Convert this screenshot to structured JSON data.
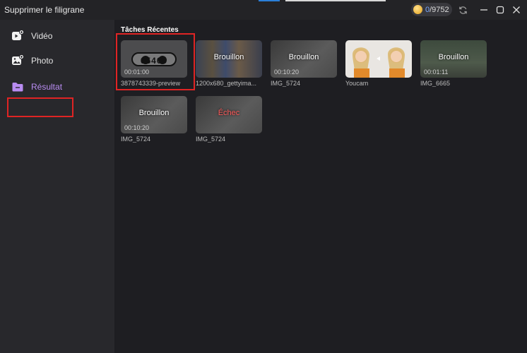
{
  "window": {
    "title": "Supprimer le filigrane",
    "credits_used": "0",
    "credits_total": "/9752"
  },
  "sidebar": {
    "items": [
      {
        "label": "Vidéo",
        "icon": "video-icon"
      },
      {
        "label": "Photo",
        "icon": "photo-icon"
      },
      {
        "label": "Résultat",
        "icon": "folder-icon",
        "active": true
      }
    ]
  },
  "main": {
    "section_title": "Tâches Récentes",
    "cards": [
      {
        "name": "3878743339-preview",
        "status": "",
        "duration": "00:01:00",
        "overlay": "05400"
      },
      {
        "name": "1200x680_gettyima...",
        "status": "Brouillon",
        "duration": ""
      },
      {
        "name": "IMG_5724",
        "status": "Brouillon",
        "duration": "00:10:20"
      },
      {
        "name": "Youcam",
        "status": "",
        "duration": ""
      },
      {
        "name": "IMG_6665",
        "status": "Brouillon",
        "duration": "00:01:11"
      },
      {
        "name": "IMG_5724",
        "status": "Brouillon",
        "duration": "00:10:20"
      },
      {
        "name": "IMG_5724",
        "status": "Échec",
        "duration": ""
      }
    ]
  },
  "colors": {
    "accent": "#b98cf2",
    "highlight": "#e02424",
    "fail": "#ff5b5b"
  }
}
